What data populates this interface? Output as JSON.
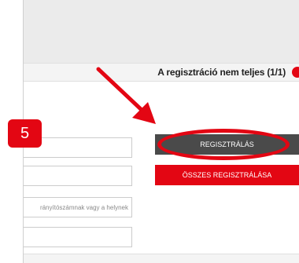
{
  "status": {
    "text": "A regisztráció nem teljes (1/1)",
    "indicator_color": "#e30613"
  },
  "form": {
    "field_1": {
      "value": "",
      "placeholder": ""
    },
    "field_2": {
      "value": "",
      "placeholder": ""
    },
    "field_3": {
      "value": "",
      "placeholder": "rányítószámnak vagy a helynek"
    },
    "field_4": {
      "value": "",
      "placeholder": ""
    }
  },
  "actions": {
    "register_label": "REGISZTRÁLÁS",
    "register_all_label": "ÖSSZES REGISZTRÁLÁSA"
  },
  "annotation": {
    "step_number": "5",
    "accent_color": "#e30613"
  }
}
